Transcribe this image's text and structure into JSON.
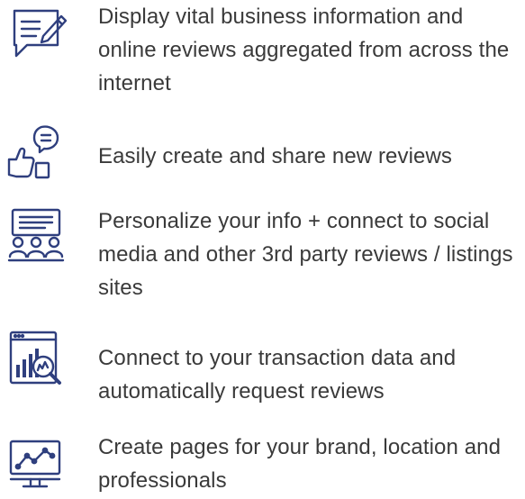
{
  "features": [
    {
      "icon": "edit-note-icon",
      "text": "Display vital business information and online reviews aggregated from across the internet"
    },
    {
      "icon": "thumbs-up-chat-icon",
      "text": "Easily create and share new reviews"
    },
    {
      "icon": "team-presentation-icon",
      "text": "Personalize your info + connect to social media and other 3rd party reviews / listings sites"
    },
    {
      "icon": "analytics-magnifier-icon",
      "text": "Connect to your transaction data and automatically request reviews"
    },
    {
      "icon": "monitor-chart-icon",
      "text": "Create pages for your brand, location and professionals"
    }
  ],
  "colors": {
    "icon": "#2f3f7e",
    "text": "#3a3a3a",
    "background": "#ffffff"
  }
}
